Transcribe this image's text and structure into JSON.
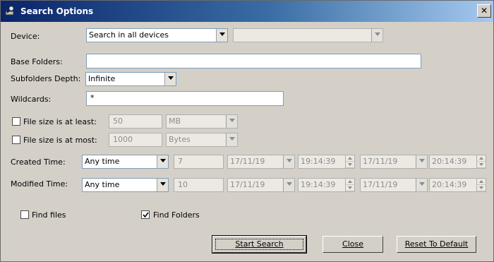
{
  "window": {
    "title": "Search Options",
    "close_glyph": "✕",
    "icon": "magnifier-icon"
  },
  "device": {
    "label": "Device:",
    "value": "Search in all devices",
    "secondary_value": ""
  },
  "base_folders": {
    "label": "Base Folders:",
    "value": ""
  },
  "subfolders_depth": {
    "label": "Subfolders Depth:",
    "value": "Infinite"
  },
  "wildcards": {
    "label": "Wildcards:",
    "value": "*"
  },
  "size_at_least": {
    "label": "File size is at least:",
    "checked": false,
    "value": "50",
    "unit": "MB"
  },
  "size_at_most": {
    "label": "File size is at most:",
    "checked": false,
    "value": "1000",
    "unit": "Bytes"
  },
  "created_time": {
    "label": "Created Time:",
    "mode": "Any time",
    "count": "7",
    "from_date": "17/11/19",
    "from_time": "19:14:39",
    "to_date": "17/11/19",
    "to_time": "20:14:39"
  },
  "modified_time": {
    "label": "Modified Time:",
    "mode": "Any time",
    "count": "10",
    "from_date": "17/11/19",
    "from_time": "19:14:39",
    "to_date": "17/11/19",
    "to_time": "20:14:39"
  },
  "find_files": {
    "label": "Find files",
    "checked": false
  },
  "find_folders": {
    "label": "Find Folders",
    "checked": true
  },
  "buttons": {
    "start": "Start Search",
    "close": "Close",
    "reset": "Reset To Default"
  }
}
